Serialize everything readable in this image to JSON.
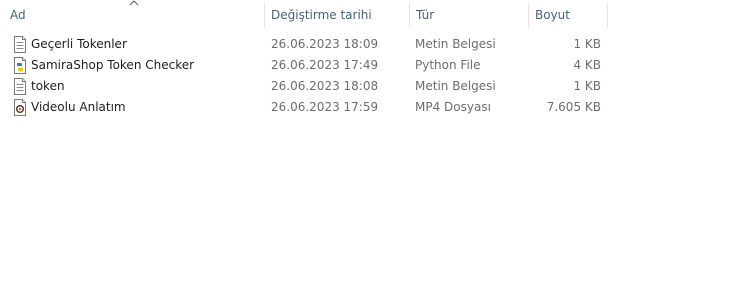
{
  "columns": {
    "name": "Ad",
    "date": "Değiştirme tarihi",
    "type": "Tür",
    "size": "Boyut",
    "sort_indicator_icon": "chevron-up-icon"
  },
  "files": [
    {
      "name": "Geçerli Tokenler",
      "date": "26.06.2023 18:09",
      "type": "Metin Belgesi",
      "size": "1 KB",
      "icon": "text-document-icon"
    },
    {
      "name": "SamiraShop Token Checker",
      "date": "26.06.2023 17:49",
      "type": "Python File",
      "size": "4 KB",
      "icon": "python-file-icon"
    },
    {
      "name": "token",
      "date": "26.06.2023 18:08",
      "type": "Metin Belgesi",
      "size": "1 KB",
      "icon": "text-document-icon"
    },
    {
      "name": "Videolu Anlatım",
      "date": "26.06.2023 17:59",
      "type": "MP4 Dosyası",
      "size": "7.605 KB",
      "icon": "video-file-icon"
    }
  ],
  "colors": {
    "header_text": "#4c607a",
    "name_text": "#1e1e1e",
    "detail_text": "#6d6d6d",
    "column_divider": "#e5e5e5"
  }
}
